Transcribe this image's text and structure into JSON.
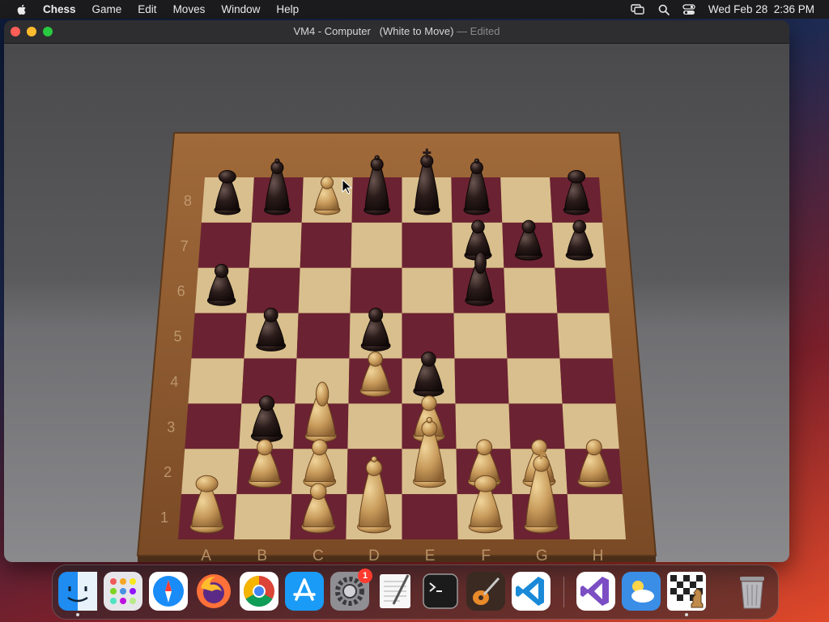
{
  "menubar": {
    "app_name": "Chess",
    "menus": [
      "Game",
      "Edit",
      "Moves",
      "Window",
      "Help"
    ],
    "clock": "Wed Feb 28  2:36 PM"
  },
  "window": {
    "title": "VM4 - Computer   (White to Move)",
    "separator": "—",
    "status": "Edited"
  },
  "board": {
    "files": [
      "A",
      "B",
      "C",
      "D",
      "E",
      "F",
      "G",
      "H"
    ],
    "ranks": [
      "8",
      "7",
      "6",
      "5",
      "4",
      "3",
      "2",
      "1"
    ],
    "light_square_color": "#d9bf8d",
    "dark_square_color": "#6b2232",
    "frame_color": "#8a5a32",
    "pieces": [
      {
        "color": "black",
        "type": "rook",
        "square": "a8"
      },
      {
        "color": "black",
        "type": "bishop",
        "square": "b8"
      },
      {
        "color": "black",
        "type": "queen",
        "square": "d8"
      },
      {
        "color": "black",
        "type": "king",
        "square": "e8"
      },
      {
        "color": "black",
        "type": "bishop",
        "square": "f8"
      },
      {
        "color": "black",
        "type": "rook",
        "square": "h8"
      },
      {
        "color": "black",
        "type": "pawn",
        "square": "f7"
      },
      {
        "color": "black",
        "type": "pawn",
        "square": "g7"
      },
      {
        "color": "black",
        "type": "pawn",
        "square": "h7"
      },
      {
        "color": "black",
        "type": "pawn",
        "square": "a6"
      },
      {
        "color": "black",
        "type": "knight",
        "square": "f6"
      },
      {
        "color": "black",
        "type": "pawn",
        "square": "b5"
      },
      {
        "color": "black",
        "type": "pawn",
        "square": "d5"
      },
      {
        "color": "black",
        "type": "pawn",
        "square": "e4"
      },
      {
        "color": "black",
        "type": "pawn",
        "square": "b3"
      },
      {
        "color": "white",
        "type": "pawn",
        "square": "c8"
      },
      {
        "color": "white",
        "type": "pawn",
        "square": "d4"
      },
      {
        "color": "white",
        "type": "knight",
        "square": "c3"
      },
      {
        "color": "white",
        "type": "pawn",
        "square": "e3"
      },
      {
        "color": "white",
        "type": "pawn",
        "square": "b2"
      },
      {
        "color": "white",
        "type": "pawn",
        "square": "c2"
      },
      {
        "color": "white",
        "type": "bishop",
        "square": "e2"
      },
      {
        "color": "white",
        "type": "pawn",
        "square": "f2"
      },
      {
        "color": "white",
        "type": "pawn",
        "square": "g2"
      },
      {
        "color": "white",
        "type": "pawn",
        "square": "h2"
      },
      {
        "color": "white",
        "type": "rook",
        "square": "a1"
      },
      {
        "color": "white",
        "type": "pawn",
        "square": "c1"
      },
      {
        "color": "white",
        "type": "queen",
        "square": "d1"
      },
      {
        "color": "white",
        "type": "rook",
        "square": "f1"
      },
      {
        "color": "white",
        "type": "king",
        "square": "g1"
      }
    ]
  },
  "dock": {
    "items": [
      {
        "name": "finder",
        "running": true
      },
      {
        "name": "launchpad",
        "running": false
      },
      {
        "name": "safari",
        "running": false
      },
      {
        "name": "firefox",
        "running": false
      },
      {
        "name": "chrome",
        "running": false
      },
      {
        "name": "app-store",
        "running": false
      },
      {
        "name": "system-settings",
        "running": false,
        "badge": "1"
      },
      {
        "name": "textedit",
        "running": false
      },
      {
        "name": "terminal",
        "running": false
      },
      {
        "name": "garageband",
        "running": false
      },
      {
        "name": "vscode",
        "running": false
      },
      {
        "name": "visual-studio",
        "running": false
      },
      {
        "name": "weather",
        "running": false
      },
      {
        "name": "chess",
        "running": true
      },
      {
        "name": "trash",
        "running": false
      }
    ]
  }
}
